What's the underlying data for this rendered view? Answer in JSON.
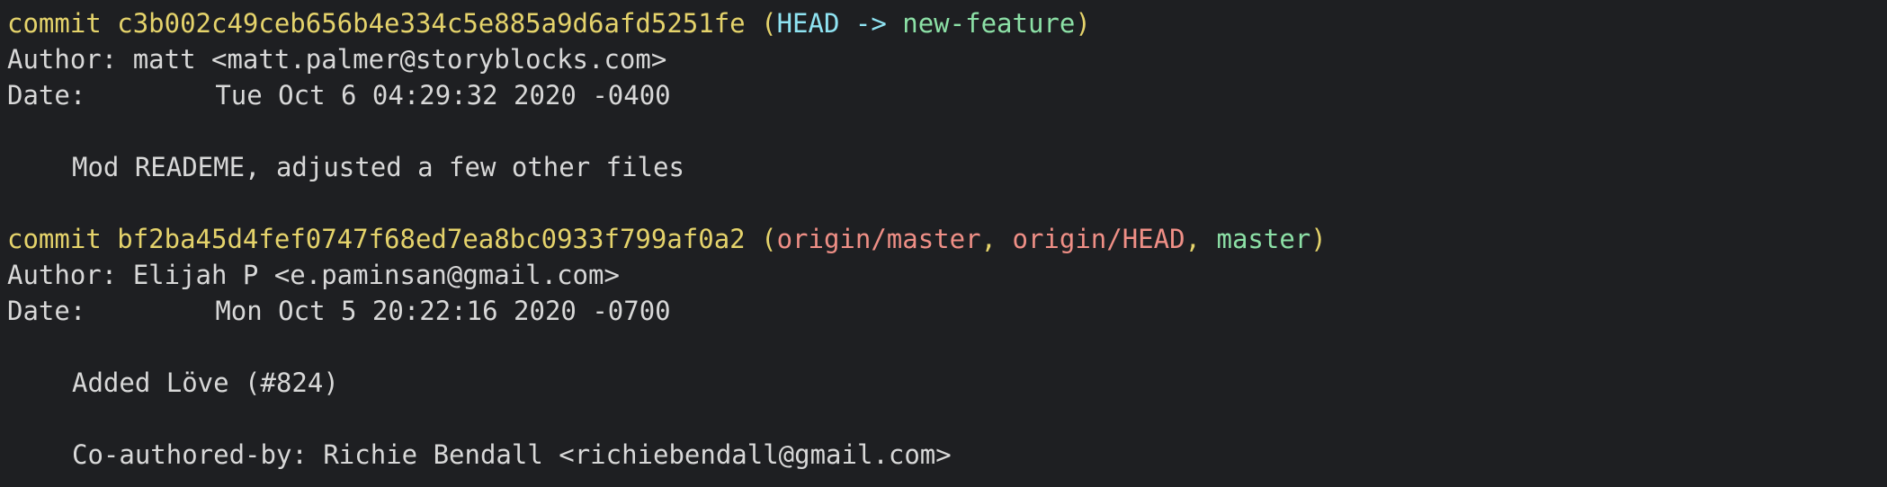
{
  "commits": [
    {
      "keyword": "commit",
      "hash": "c3b002c49ceb656b4e334c5e885a9d6afd5251fe",
      "refs": {
        "head": "HEAD",
        "arrow": "->",
        "branch": "new-feature"
      },
      "author_label": "Author:",
      "author": "matt <matt.palmer@storyblocks.com>",
      "date_label": "Date:",
      "date": "Tue Oct 6 04:29:32 2020 -0400",
      "message": "Mod READEME, adjusted a few other files"
    },
    {
      "keyword": "commit",
      "hash": "bf2ba45d4fef0747f68ed7ea8bc0933f799af0a2",
      "refs": {
        "remote_master": "origin/master",
        "remote_head": "origin/HEAD",
        "local_master": "master"
      },
      "author_label": "Author:",
      "author": "Elijah P <e.paminsan@gmail.com>",
      "date_label": "Date:",
      "date": "Mon Oct 5 20:22:16 2020 -0700",
      "message": "Added Löve (#824)",
      "trailer": "Co-authored-by: Richie Bendall <richiebendall@gmail.com>"
    }
  ],
  "punctuation": {
    "open_paren": "(",
    "close_paren": ")",
    "comma": ","
  },
  "colors": {
    "background": "#1e1f22",
    "text": "#d8d8d8",
    "commit_yellow": "#e5d36b",
    "head_cyan": "#8fe3f2",
    "branch_green": "#8ce0a6",
    "remote_red": "#ef8f86"
  }
}
